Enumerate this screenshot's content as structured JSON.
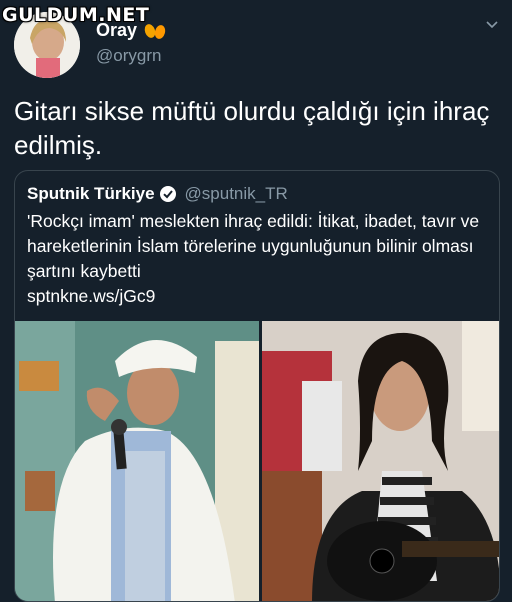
{
  "watermark": "GULDUM.NET",
  "author": {
    "display_name": "Oray",
    "handle": "@orygrn"
  },
  "tweet": {
    "text": "Gitarı sikse müftü olurdu çaldığı için ihraç edilmiş."
  },
  "quoted": {
    "name": "Sputnik Türkiye",
    "handle": "@sputnik_TR",
    "text": "'Rockçı imam' meslekten ihraç edildi: İtikat, ibadet, tavır ve hareketlerinin İslam törelerine uygunluğunun bilinir olması şartını kaybetti",
    "link": "sptnkne.ws/jGc9"
  },
  "icons": {
    "emoji": "peach-emoji-icon",
    "verified": "verified-badge-icon",
    "menu": "chevron-down-icon"
  },
  "colors": {
    "background": "#15202b",
    "secondary_text": "#8899a6",
    "border": "#38444d",
    "verified": "#1da1f2"
  }
}
